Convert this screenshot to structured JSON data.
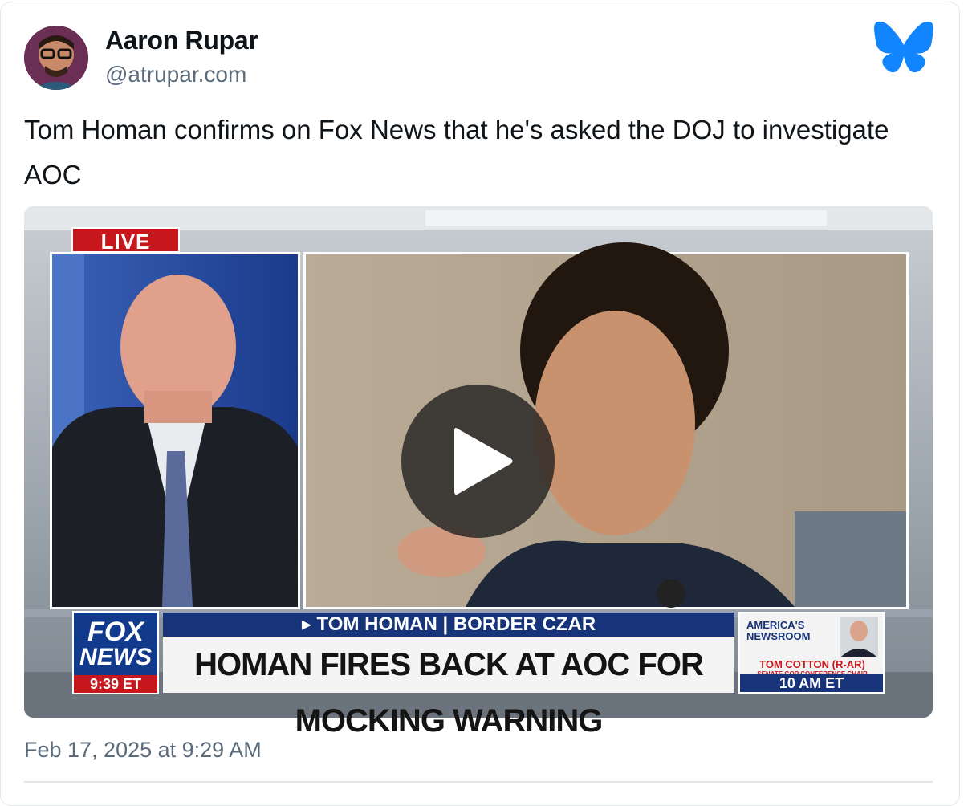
{
  "post": {
    "author_name": "Aaron Rupar",
    "author_handle": "@atrupar.com",
    "text": "Tom Homan confirms on Fox News that he's asked the DOJ to investigate AOC",
    "timestamp": "Feb 17, 2025 at 9:29 AM",
    "platform_icon": "bluesky-butterfly-icon",
    "accent_color": "#1185fe"
  },
  "video": {
    "live_label": "LIVE",
    "network_logo_line1": "FOX",
    "network_logo_line2": "NEWS",
    "clock": "9:39 ET",
    "chyron_top": "▸ TOM HOMAN | BORDER CZAR",
    "chyron_headline": "HOMAN FIRES BACK AT AOC FOR MOCKING WARNING",
    "promo_show": "AMERICA'S NEWSROOM",
    "promo_guest": "TOM COTTON (R-AR)",
    "promo_guest_title": "SENATE GOP CONFERENCE CHAIR",
    "promo_time": "10 AM ET",
    "play_icon": "play-icon"
  }
}
